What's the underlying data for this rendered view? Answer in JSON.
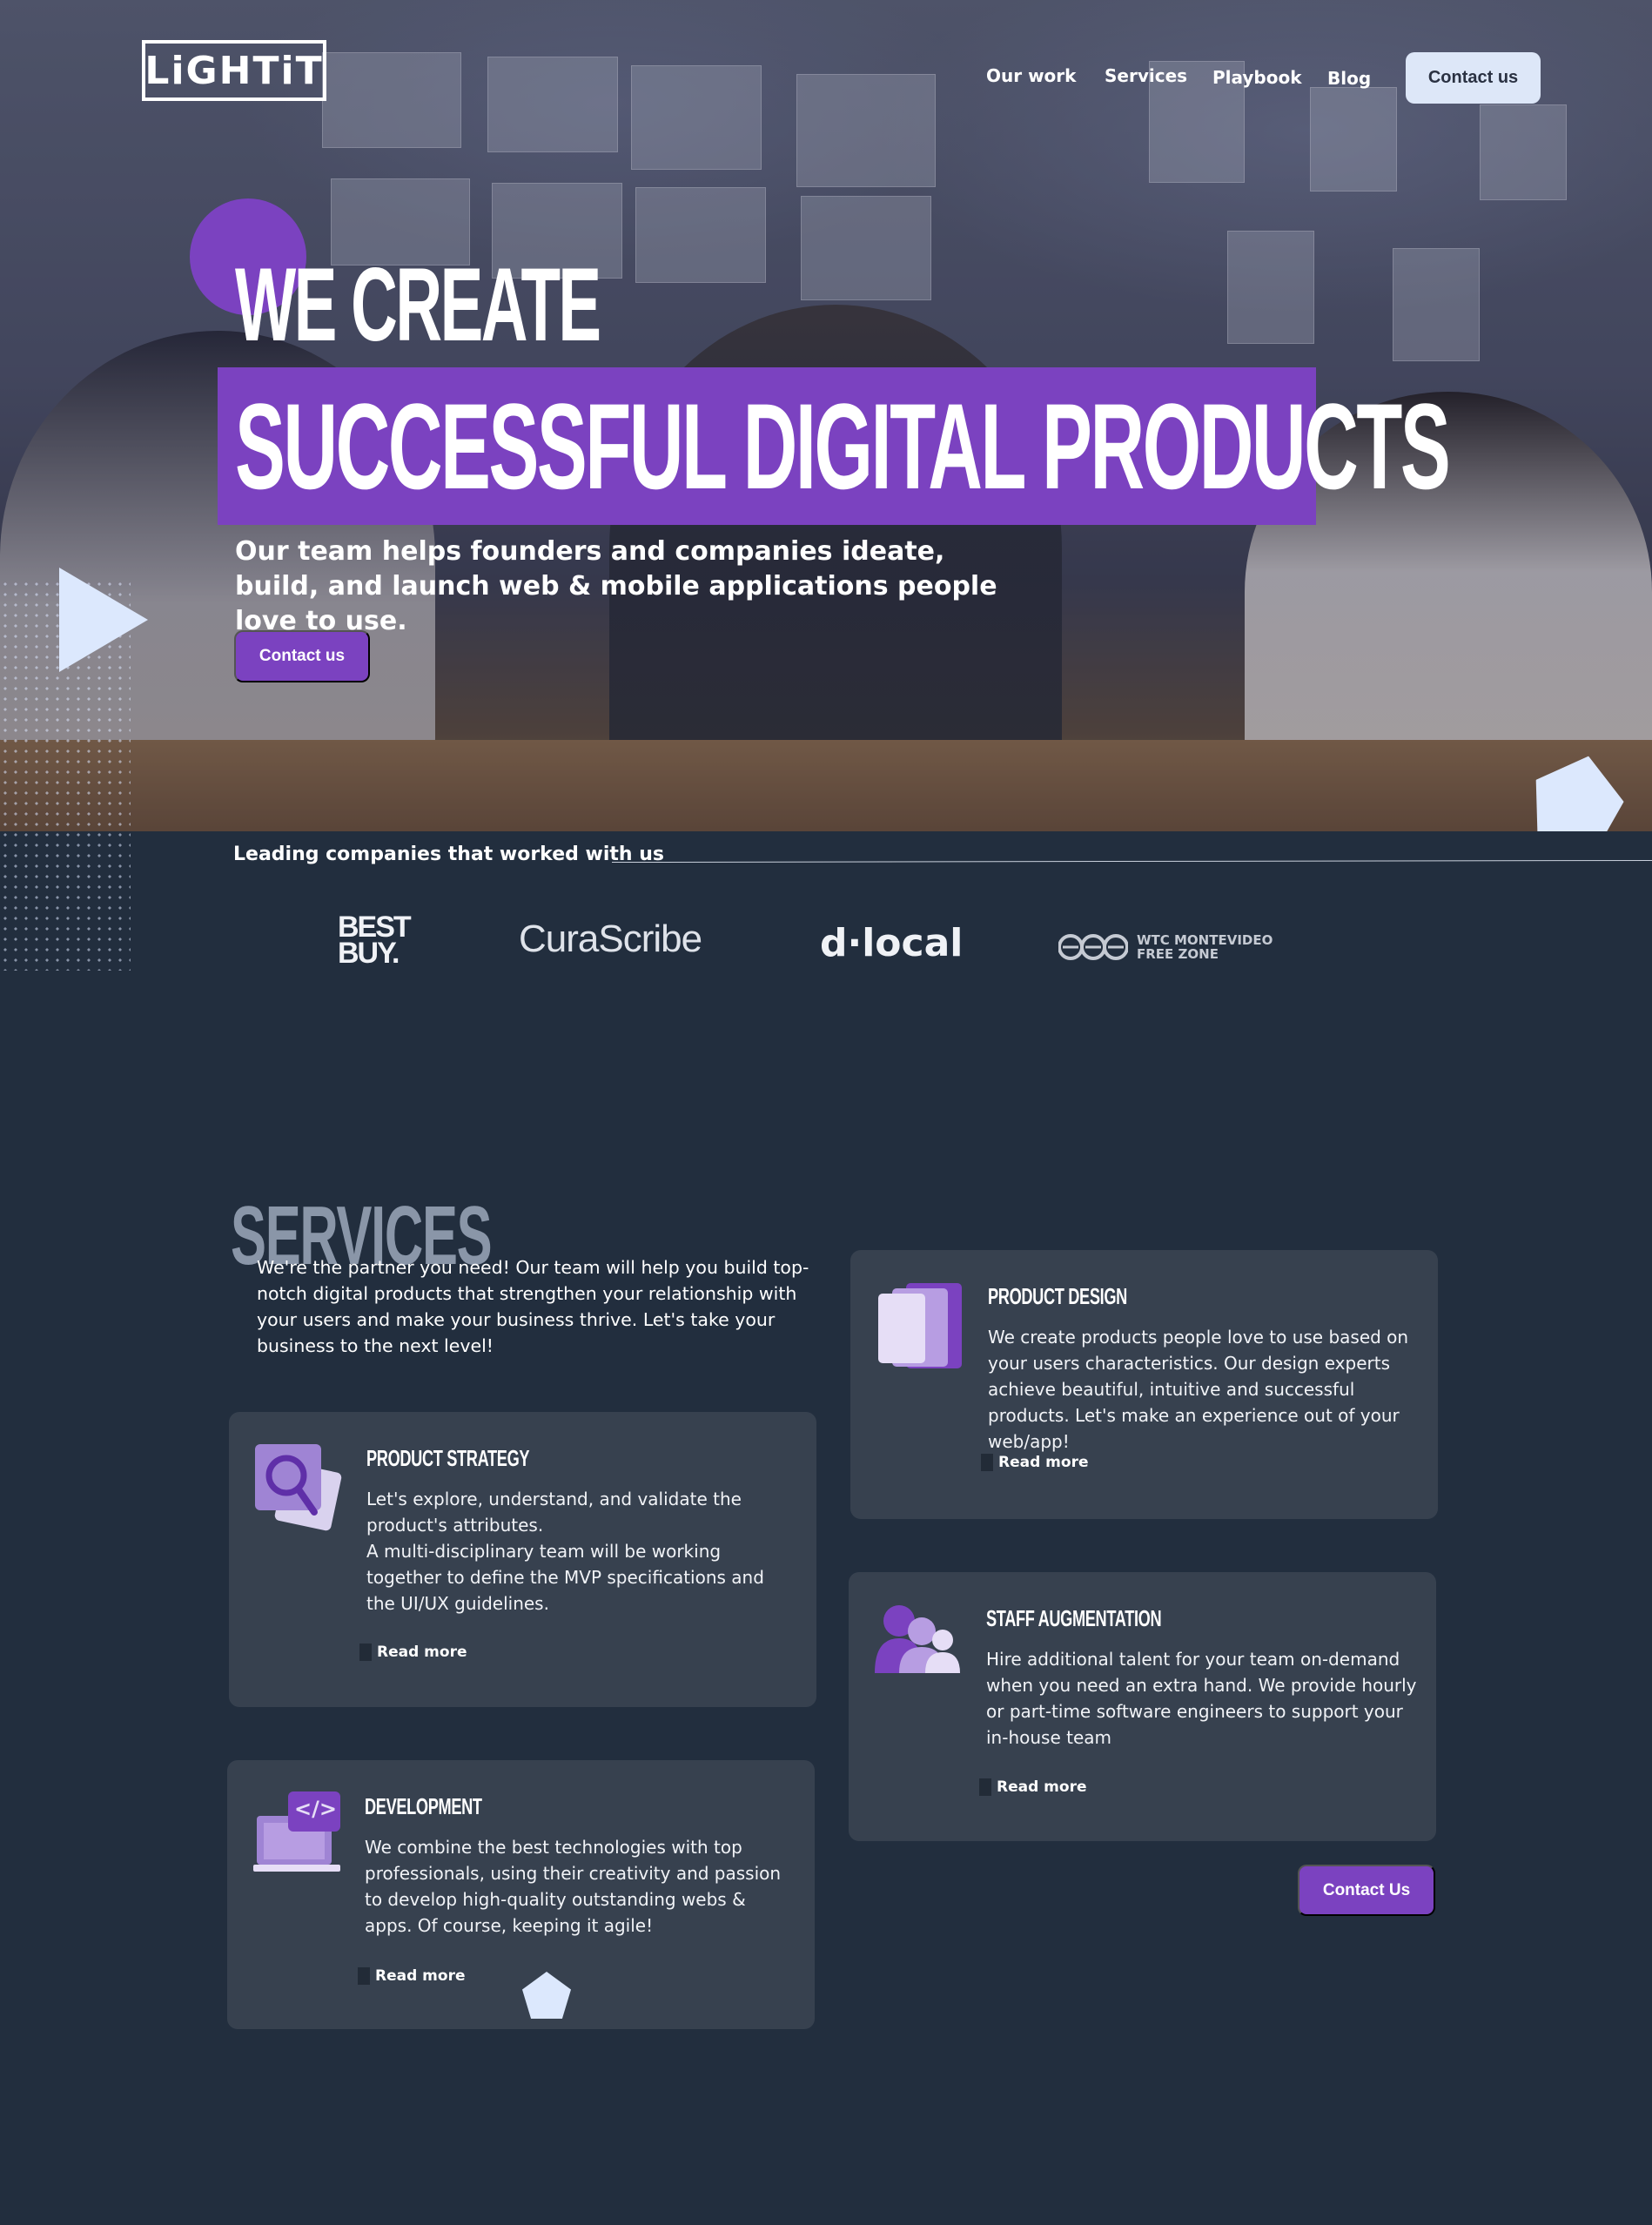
{
  "header": {
    "logo_text": "LiGHTiT",
    "nav": [
      "Our work",
      "Services",
      "Playbook",
      "Blog"
    ],
    "contact_label": "Contact us"
  },
  "hero": {
    "headline_line1": "WE CREATE",
    "headline_line2": "SUCCESSFUL DIGITAL PRODUCTS",
    "subtitle": "Our team helps founders and companies ideate, build, and launch web & mobile applications people love to use.",
    "cta_label": "Contact us"
  },
  "partners": {
    "label": "Leading companies that worked with us",
    "logos": {
      "bestbuy_line1": "BEST",
      "bestbuy_line2": "BUY.",
      "curascribe": "CuraScribe",
      "dlocal": "d·local",
      "wtc_line1": "WTC MONTEVIDEO",
      "wtc_line2": "FREE ZONE"
    }
  },
  "services": {
    "title": "SERVICES",
    "intro": "We're the partner you need! Our team will help you build top-notch digital products that strengthen your relationship with your users and make your business thrive. Let's take your business to the next level!",
    "cards": [
      {
        "title": "PRODUCT STRATEGY",
        "text": "Let's explore, understand, and validate the product's attributes.\nA multi-disciplinary team will be working together to define the MVP specifications and the UI/UX guidelines.",
        "read_more": "Read more",
        "icon": "magnifier-icon"
      },
      {
        "title": "PRODUCT DESIGN",
        "text": "We create products people love to use based on your users characteristics. Our design experts achieve beautiful, intuitive and successful products. Let's make an experience out of your web/app!",
        "read_more": "Read more",
        "icon": "stacked-pages-icon"
      },
      {
        "title": "DEVELOPMENT",
        "text": "We combine the best technologies with top professionals, using their creativity and passion to develop high-quality outstanding webs & apps. Of course, keeping it agile!",
        "read_more": "Read more",
        "icon": "laptop-code-icon",
        "code_glyph": "</>"
      },
      {
        "title": "STAFF AUGMENTATION",
        "text": "Hire additional talent for your team on-demand when you need an extra hand. We provide hourly or part-time software engineers to support your in-house team",
        "read_more": "Read more",
        "icon": "people-group-icon"
      }
    ],
    "cta_label": "Contact Us"
  },
  "colors": {
    "background": "#222e3e",
    "accent_purple": "#7b42c0",
    "card": "#37414f",
    "light_blue": "#dce8fd"
  }
}
